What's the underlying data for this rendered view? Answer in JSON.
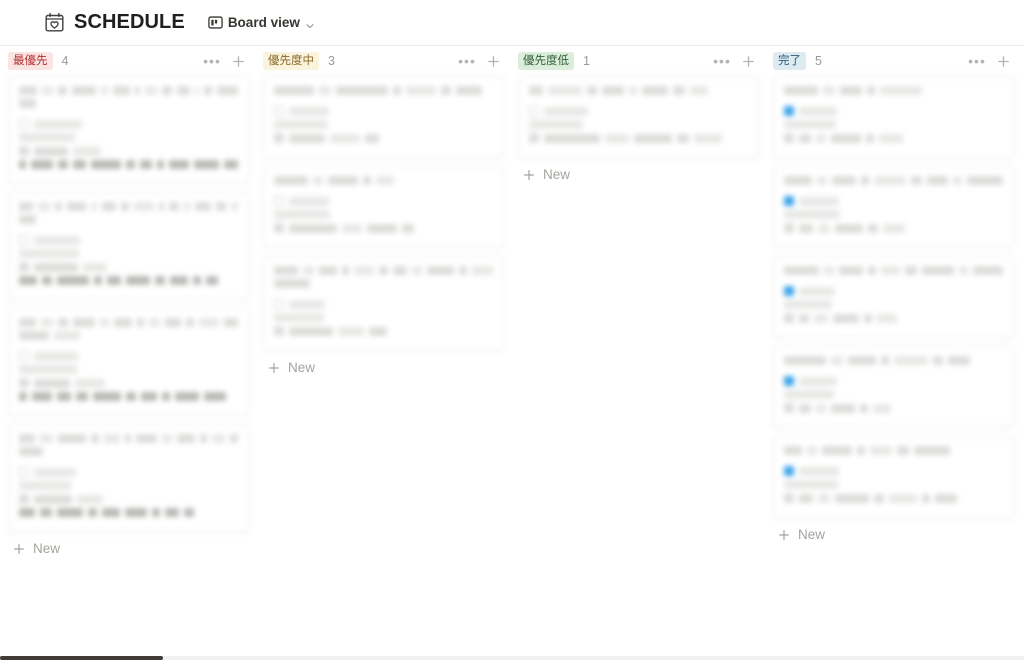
{
  "header": {
    "db_icon": "calendar-heart-icon",
    "title": "SCHEDULE",
    "view": {
      "icon": "board-view-icon",
      "label": "Board view",
      "chevron": "chevron-down-icon"
    }
  },
  "board": {
    "new_label": "New",
    "more_glyph": "•••",
    "columns": [
      {
        "id": "highest",
        "badge": "最優先",
        "badge_bg": "#fbe4e4",
        "badge_fg": "#b5302f",
        "count": "4",
        "cards": [
          {
            "checkbox": "unchecked",
            "title_widths": [
              22,
              14,
              10,
              30,
              8,
              22,
              6,
              14,
              12,
              16,
              6,
              9,
              26
            ],
            "sub_widths": [
              17
            ],
            "prop_label_widths": [
              48
            ],
            "prop_value_widths": [
              56
            ],
            "prop2_widths": [
              34,
              28
            ],
            "footer_widths": [
              7,
              22,
              10,
              14,
              30,
              9,
              12,
              7,
              20,
              26,
              14
            ]
          },
          {
            "checkbox": "unchecked",
            "title_widths": [
              20,
              16,
              10,
              26,
              8,
              20,
              10,
              28,
              7,
              14,
              9,
              22,
              13,
              10
            ],
            "sub_widths": [
              17
            ],
            "prop_label_widths": [
              46
            ],
            "prop_value_widths": [
              60
            ],
            "prop2_widths": [
              44,
              24
            ],
            "footer_widths": [
              18,
              10,
              32,
              8,
              14,
              24,
              10,
              18,
              8,
              12
            ]
          },
          {
            "checkbox": "unchecked",
            "title_widths": [
              20,
              14,
              12,
              26,
              10,
              22,
              8,
              13,
              18,
              10,
              24,
              16
            ],
            "sub_widths": [
              30,
              26
            ],
            "prop_label_widths": [
              44
            ],
            "prop_value_widths": [
              58
            ],
            "prop2_widths": [
              36,
              30
            ],
            "footer_widths": [
              8,
              20,
              14,
              12,
              28,
              10,
              16,
              8,
              24,
              22
            ]
          },
          {
            "checkbox": "unchecked",
            "title_widths": [
              20,
              16,
              34,
              10,
              20,
              8,
              26,
              12,
              22,
              9,
              16,
              10
            ],
            "sub_widths": [
              24
            ],
            "prop_label_widths": [
              42
            ],
            "prop_value_widths": [
              52
            ],
            "prop2_widths": [
              38,
              26
            ],
            "footer_widths": [
              16,
              12,
              26,
              9,
              18,
              22,
              8,
              14,
              10
            ]
          }
        ]
      },
      {
        "id": "medium",
        "badge": "優先度中",
        "badge_bg": "#faf3dd",
        "badge_fg": "#8a6a29",
        "count": "3",
        "cards": [
          {
            "checkbox": "unchecked",
            "title_widths": [
              40,
              12,
              52,
              8,
              30,
              10,
              26
            ],
            "prop_label_widths": [
              40
            ],
            "prop_value_widths": [
              54
            ],
            "prop2_widths": [
              36,
              30,
              14
            ]
          },
          {
            "checkbox": "unchecked",
            "title_widths": [
              34,
              10,
              30,
              8,
              18
            ],
            "prop_label_widths": [
              40
            ],
            "prop_value_widths": [
              56
            ],
            "prop2_widths": [
              48,
              20,
              30,
              12
            ]
          },
          {
            "checkbox": "unchecked",
            "title_widths": [
              30,
              14,
              22,
              8,
              26,
              10,
              18,
              12,
              34,
              10,
              26
            ],
            "sub_widths": [
              36
            ],
            "prop_label_widths": [
              36
            ],
            "prop_value_widths": [
              50
            ],
            "prop2_widths": [
              44,
              26,
              18
            ]
          }
        ]
      },
      {
        "id": "low",
        "badge": "優先度低",
        "badge_bg": "#dbeddb",
        "badge_fg": "#37613b",
        "count": "1",
        "cards": [
          {
            "checkbox": "unchecked",
            "title_widths": [
              14,
              34,
              10,
              22,
              8,
              26,
              12,
              18
            ],
            "prop_label_widths": [
              44
            ],
            "prop_value_widths": [
              54
            ],
            "prop2_widths": [
              56,
              24,
              38,
              12,
              28
            ]
          }
        ]
      },
      {
        "id": "done",
        "badge": "完了",
        "badge_bg": "#ddebf1",
        "badge_fg": "#2b5e7c",
        "count": "5",
        "cards": [
          {
            "checkbox": "checked",
            "title_widths": [
              34,
              12,
              22,
              8,
              42
            ],
            "prop_label_widths": [
              38
            ],
            "prop_value_widths": [
              52
            ],
            "prop2_widths": [
              12,
              10,
              30,
              8,
              24
            ]
          },
          {
            "checkbox": "checked",
            "title_widths": [
              30,
              10,
              26,
              8,
              34,
              12,
              22,
              10,
              38
            ],
            "prop_label_widths": [
              40
            ],
            "prop_value_widths": [
              56
            ],
            "prop2_widths": [
              14,
              12,
              28,
              10,
              22
            ]
          },
          {
            "checkbox": "checked",
            "title_widths": [
              36,
              10,
              24,
              8,
              20,
              12,
              32,
              10,
              30
            ],
            "prop_label_widths": [
              36
            ],
            "prop_value_widths": [
              48
            ],
            "prop2_widths": [
              10,
              14,
              26,
              8,
              20
            ]
          },
          {
            "checkbox": "checked",
            "title_widths": [
              42,
              12,
              28,
              8,
              34,
              10,
              22
            ],
            "prop_label_widths": [
              38
            ],
            "prop_value_widths": [
              50
            ],
            "prop2_widths": [
              12,
              10,
              24,
              8,
              18
            ]
          },
          {
            "checkbox": "checked",
            "title_widths": [
              18,
              10,
              30,
              8,
              22,
              12,
              36
            ],
            "prop_label_widths": [
              40
            ],
            "prop_value_widths": [
              54
            ],
            "prop2_widths": [
              14,
              12,
              34,
              10,
              28,
              8,
              22
            ]
          }
        ]
      }
    ]
  }
}
